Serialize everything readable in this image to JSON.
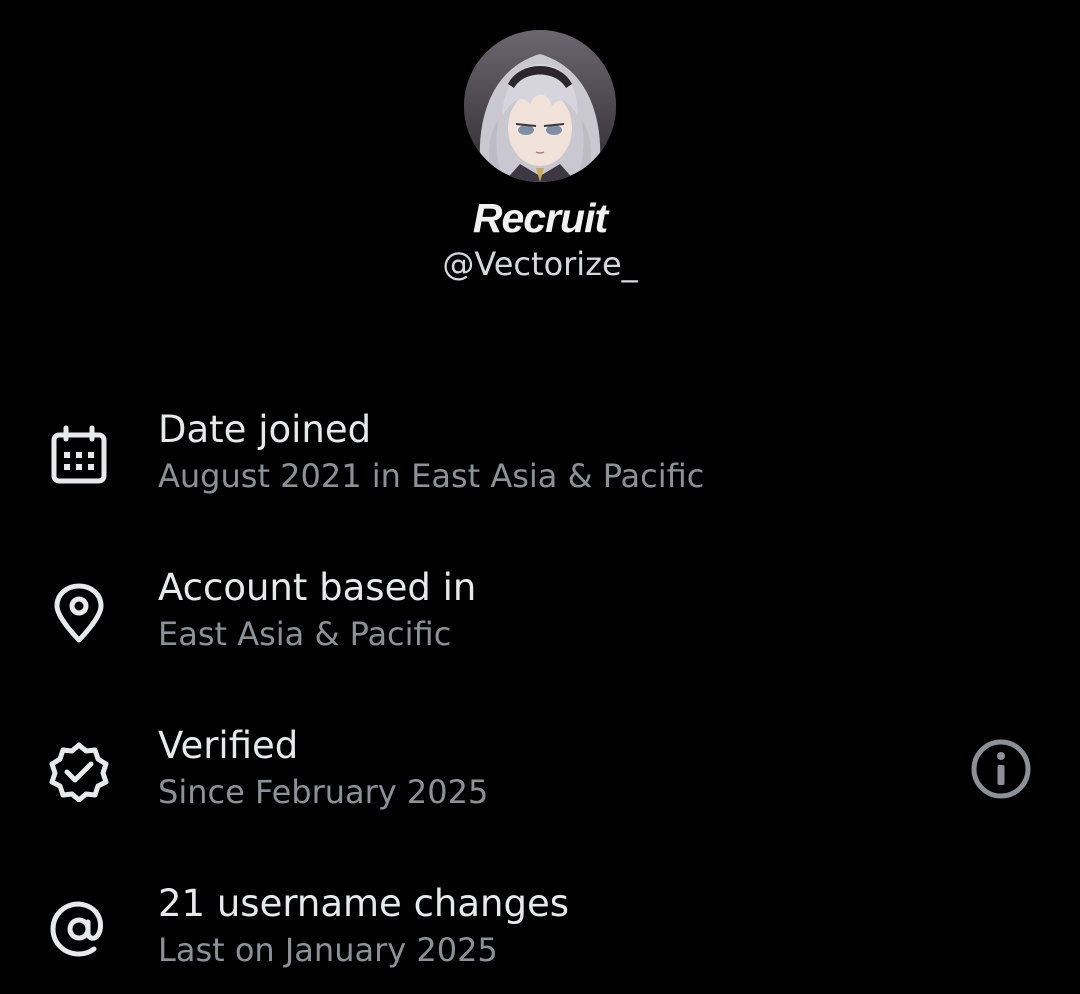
{
  "profile": {
    "display_name": "Recruit",
    "handle": "@Vectorize_"
  },
  "rows": [
    {
      "icon": "calendar-icon",
      "title": "Date joined",
      "subtitle": "August 2021 in East Asia & Pacific"
    },
    {
      "icon": "location-pin-icon",
      "title": "Account based in",
      "subtitle": "East Asia & Pacific"
    },
    {
      "icon": "verified-badge-icon",
      "title": "Verified",
      "subtitle": "Since February 2025"
    },
    {
      "icon": "at-sign-icon",
      "title": "21 username changes",
      "subtitle": "Last on January 2025"
    }
  ],
  "colors": {
    "background": "#000000",
    "text_primary": "#e7e9ea",
    "text_secondary": "#8b9196",
    "icon": "#e7e9ea",
    "info_icon": "#8b9196"
  }
}
